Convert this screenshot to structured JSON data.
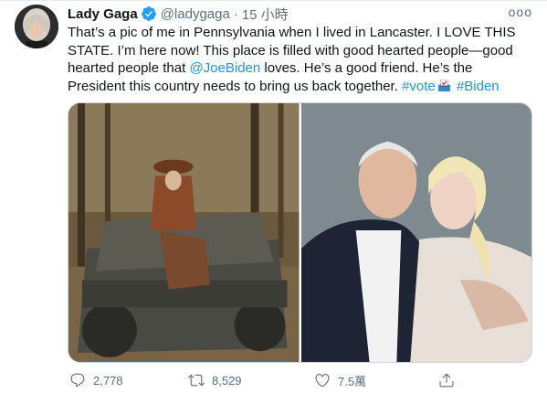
{
  "tweet": {
    "display_name": "Lady Gaga",
    "handle": "@ladygaga",
    "separator": "·",
    "time": "15 小時",
    "more_label": "ooo",
    "body": {
      "line1": "That’s a pic of me in Pennsylvania when I lived in Lancaster. I LOVE THIS",
      "line2": "STATE. I’m here now! This place is filled with good hearted people—good",
      "line3_pre": "hearted people that ",
      "mention": "@JoeBiden",
      "line3_post": " loves. He’s a good friend. He’s the",
      "line4_pre": "President this country needs to bring us back together. ",
      "hashtag_vote": "#vote",
      "hashtag_biden": "#Biden"
    },
    "icons": {
      "verified": "verified-badge-icon",
      "ballot": "ballot-box-icon",
      "reply": "reply-icon",
      "retweet": "retweet-icon",
      "like": "heart-icon",
      "share": "share-icon"
    },
    "actions": {
      "reply_count": "2,778",
      "retweet_count": "8,529",
      "like_count": "7.5萬"
    },
    "colors": {
      "link": "#1b95e0",
      "verified": "#1da1f2",
      "secondary_text": "#5b7083"
    }
  }
}
